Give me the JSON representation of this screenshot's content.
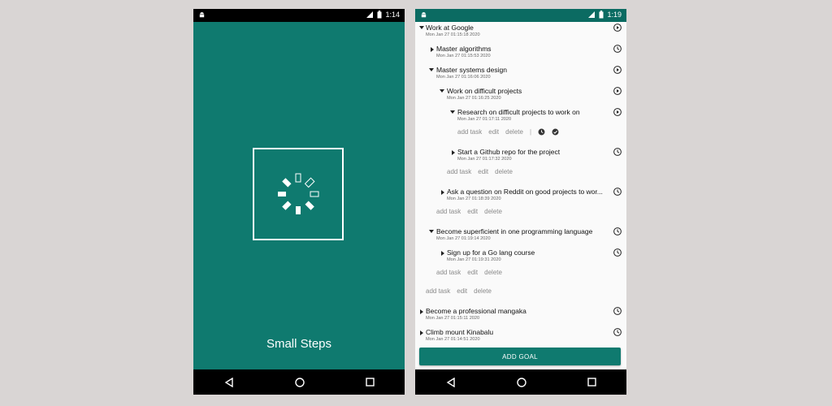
{
  "colors": {
    "primary": "#0f7a6f",
    "status_bar_dark": "#0b6b62",
    "background": "#d9d5d4",
    "nav_bar": "#000000"
  },
  "left_screen": {
    "status_time": "1:14",
    "app_name": "Small Steps",
    "icons": [
      "android-icon",
      "signal-icon",
      "battery-icon",
      "spinner-logo-icon"
    ]
  },
  "right_screen": {
    "status_time": "1:19",
    "goals": [
      {
        "title": "Work at Google",
        "date": "Mon Jan 27 01:15:18 2020",
        "expanded": true,
        "icon": "play-icon"
      },
      {
        "title": "Master algorithms",
        "date": "Mon Jan 27 01:15:53 2020",
        "expanded": false,
        "icon": "clock-icon"
      },
      {
        "title": "Master systems design",
        "date": "Mon Jan 27 01:16:06 2020",
        "expanded": true,
        "icon": "play-icon"
      },
      {
        "title": "Work on difficult projects",
        "date": "Mon Jan 27 01:16:25 2020",
        "expanded": true,
        "icon": "play-icon"
      },
      {
        "title": "Research on difficult projects to work on",
        "date": "Mon Jan 27 01:17:11 2020",
        "expanded": true,
        "icon": "play-icon"
      },
      {
        "title": "Start a Github repo for the project",
        "date": "Mon Jan 27 01:17:32 2020",
        "expanded": false,
        "icon": "clock-icon"
      },
      {
        "title": "Ask a question on Reddit on good projects to wor...",
        "date": "Mon Jan 27 01:18:39 2020",
        "expanded": false,
        "icon": "clock-icon"
      },
      {
        "title": "Become superficient in one programming language",
        "date": "Mon Jan 27 01:19:14 2020",
        "expanded": true,
        "icon": "clock-icon"
      },
      {
        "title": "Sign up for a Go lang course",
        "date": "Mon Jan 27 01:19:31 2020",
        "expanded": false,
        "icon": "clock-icon"
      },
      {
        "title": "Become a professional mangaka",
        "date": "Mon Jan 27 01:15:11 2020",
        "expanded": false,
        "icon": "clock-icon"
      },
      {
        "title": "Climb mount Kinabalu",
        "date": "Mon Jan 27 01:14:51 2020",
        "expanded": false,
        "icon": "clock-icon"
      }
    ],
    "actions": {
      "add_task": "add task",
      "edit": "edit",
      "delete": "delete",
      "separator": "|"
    },
    "add_goal_label": "ADD GOAL"
  }
}
